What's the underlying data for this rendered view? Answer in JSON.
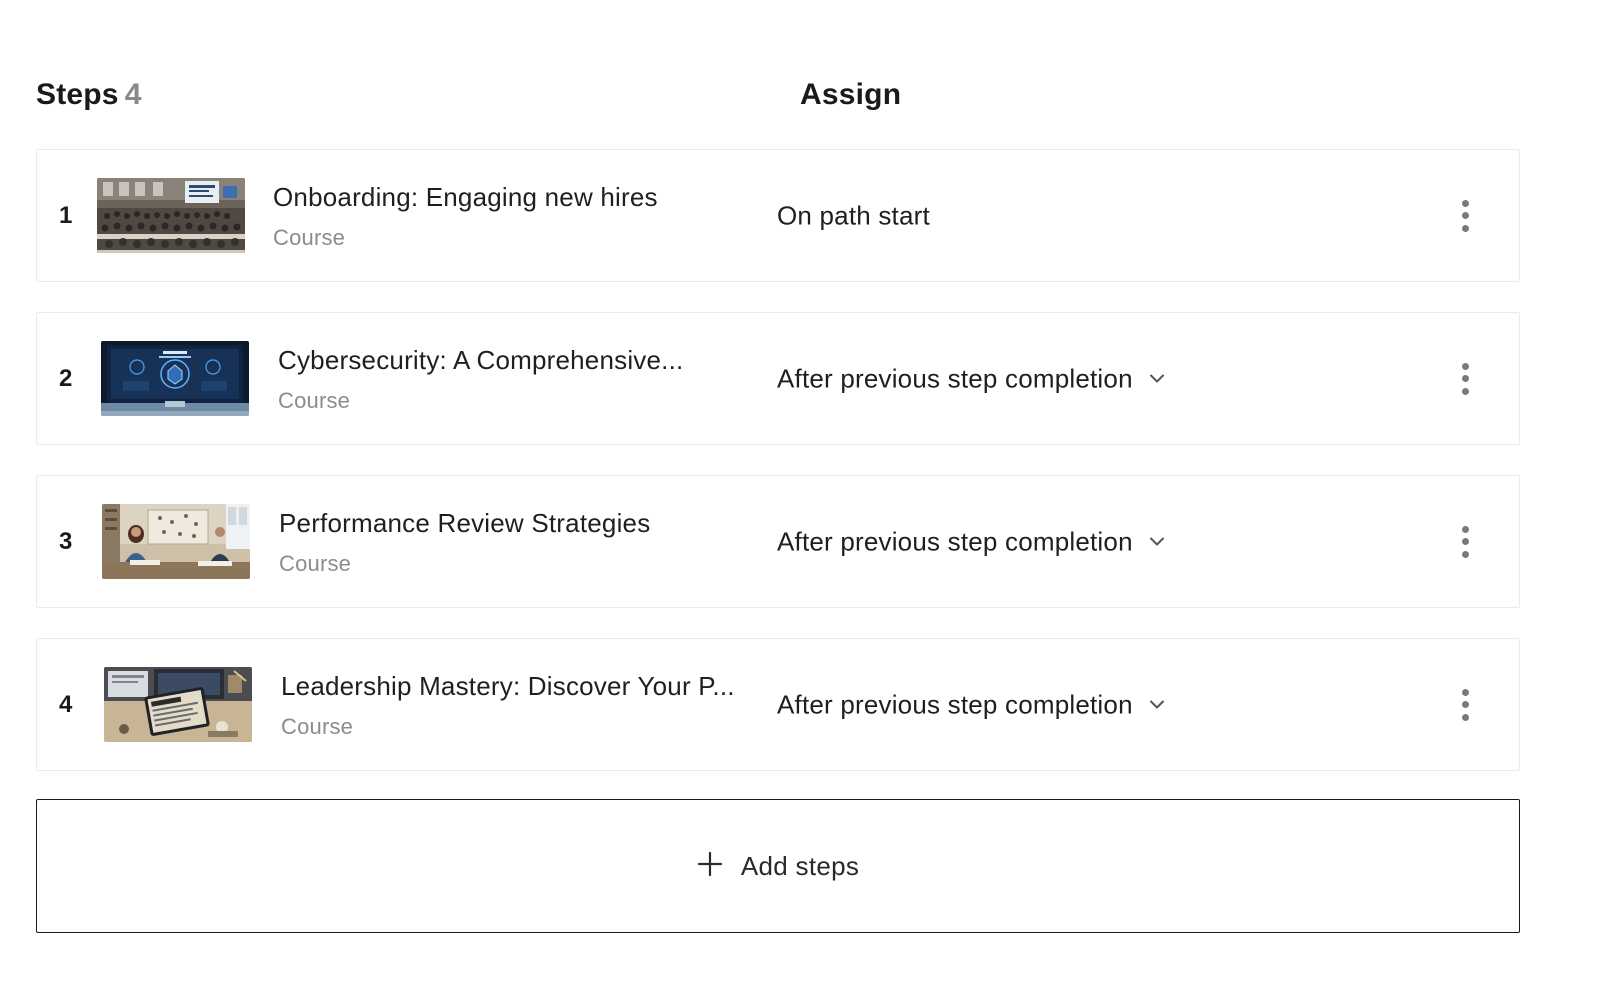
{
  "header": {
    "steps_label": "Steps",
    "steps_count": "4",
    "assign_label": "Assign"
  },
  "steps": [
    {
      "number": "1",
      "title": "Onboarding: Engaging new hires",
      "type": "Course",
      "assign": "On path start",
      "has_dropdown": false,
      "thumbnail": "classroom-presentation-image"
    },
    {
      "number": "2",
      "title": "Cybersecurity: A Comprehensive...",
      "type": "Course",
      "assign": "After previous step completion",
      "has_dropdown": true,
      "thumbnail": "cybersecurity-monitor-image"
    },
    {
      "number": "3",
      "title": "Performance Review Strategies",
      "type": "Course",
      "assign": "After previous step completion",
      "has_dropdown": true,
      "thumbnail": "performance-review-meeting-image"
    },
    {
      "number": "4",
      "title": "Leadership Mastery: Discover Your P...",
      "type": "Course",
      "assign": "After previous step completion",
      "has_dropdown": true,
      "thumbnail": "leadership-tablet-desk-image"
    }
  ],
  "add_steps": {
    "icon": "plus-icon",
    "label": "Add steps"
  }
}
